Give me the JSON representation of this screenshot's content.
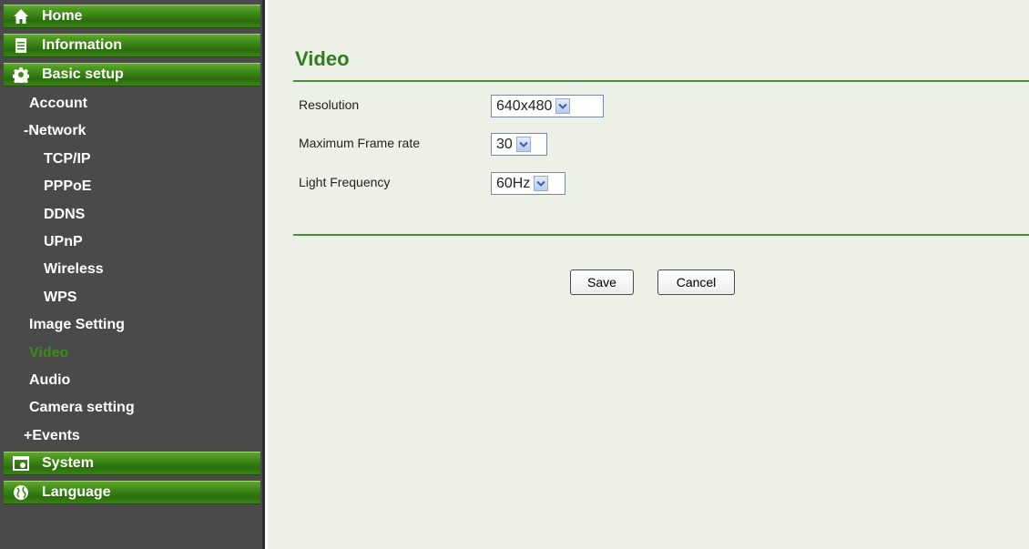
{
  "sidebar": {
    "nav": {
      "home": "Home",
      "information": "Information",
      "basic_setup": "Basic setup",
      "system": "System",
      "language": "Language"
    },
    "basic_items": {
      "account": "Account",
      "network": "-Network",
      "tcpip": "TCP/IP",
      "pppoe": "PPPoE",
      "ddns": "DDNS",
      "upnp": "UPnP",
      "wireless": "Wireless",
      "wps": "WPS",
      "image_setting": "Image Setting",
      "video": "Video",
      "audio": "Audio",
      "camera_setting": "Camera setting",
      "events": "+Events"
    },
    "active_item": "Video"
  },
  "main": {
    "title": "Video",
    "fields": {
      "resolution": {
        "label": "Resolution",
        "value": "640x480"
      },
      "frame_rate": {
        "label": "Maximum Frame rate",
        "value": "30"
      },
      "light_frequency": {
        "label": "Light Frequency",
        "value": "60Hz"
      }
    },
    "buttons": {
      "save": "Save",
      "cancel": "Cancel"
    }
  },
  "colors": {
    "sidebar_bg": "#4a4a4a",
    "nav_green": "#3f8a1a",
    "active_item": "#3d8b17",
    "title_green": "#2f7d1d",
    "content_bg": "#edf0e7"
  },
  "icons": {
    "home": "home-icon",
    "information": "document-icon",
    "basic_setup": "gear-icon",
    "system": "window-icon",
    "language": "globe-icon"
  }
}
